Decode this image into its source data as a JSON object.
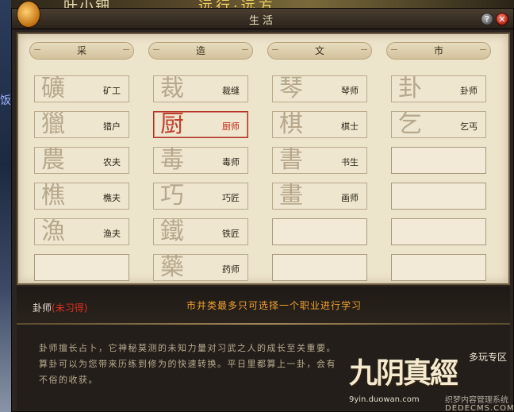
{
  "background": {
    "top_text_left": "叶小钿",
    "top_text_right": "远行·远方",
    "side_text": "饭"
  },
  "window": {
    "title": "生活",
    "help_label": "?",
    "close_label": "✕"
  },
  "columns": [
    {
      "header": "采",
      "slots": [
        {
          "glyph": "礦",
          "name": "矿工"
        },
        {
          "glyph": "獵",
          "name": "猎户"
        },
        {
          "glyph": "農",
          "name": "农夫"
        },
        {
          "glyph": "樵",
          "name": "樵夫"
        },
        {
          "glyph": "漁",
          "name": "渔夫"
        },
        {
          "glyph": "",
          "name": ""
        }
      ]
    },
    {
      "header": "造",
      "slots": [
        {
          "glyph": "裁",
          "name": "裁缝"
        },
        {
          "glyph": "厨",
          "name": "厨师"
        },
        {
          "glyph": "毒",
          "name": "毒师"
        },
        {
          "glyph": "巧",
          "name": "巧匠"
        },
        {
          "glyph": "鐵",
          "name": "铁匠"
        },
        {
          "glyph": "藥",
          "name": "药师"
        }
      ]
    },
    {
      "header": "文",
      "slots": [
        {
          "glyph": "琴",
          "name": "琴师"
        },
        {
          "glyph": "棋",
          "name": "棋士"
        },
        {
          "glyph": "書",
          "name": "书生"
        },
        {
          "glyph": "畫",
          "name": "画师"
        },
        {
          "glyph": "",
          "name": ""
        },
        {
          "glyph": "",
          "name": ""
        }
      ]
    },
    {
      "header": "市",
      "slots": [
        {
          "glyph": "卦",
          "name": "卦师"
        },
        {
          "glyph": "乞",
          "name": "乞丐"
        },
        {
          "glyph": "",
          "name": ""
        },
        {
          "glyph": "",
          "name": ""
        },
        {
          "glyph": "",
          "name": ""
        },
        {
          "glyph": "",
          "name": ""
        }
      ]
    }
  ],
  "selected": {
    "column": 1,
    "slot": 1
  },
  "info": {
    "job_name": "卦师",
    "job_status_open": "(",
    "job_status": "未习得",
    "job_status_close": ")",
    "notice": "市井类最多只可选择一个职业进行学习",
    "description": "卦师擅长占卜，它神秘莫测的未知力量对习武之人的成长至关重要。算卦可以为您带来历练到修为的快速转换。平日里都算上一卦，会有不俗的收获。"
  },
  "branding": {
    "logo": "九阴真經",
    "tag": "多玩专区",
    "url": "9yin.duowan.com",
    "watermark_1": "织梦内容管理系统",
    "watermark_2": "DEDECMS.COM"
  },
  "colors": {
    "parchment": "#ede4cc",
    "selected_border": "#b03020",
    "notice": "#f0a030",
    "status": "#e03020"
  }
}
